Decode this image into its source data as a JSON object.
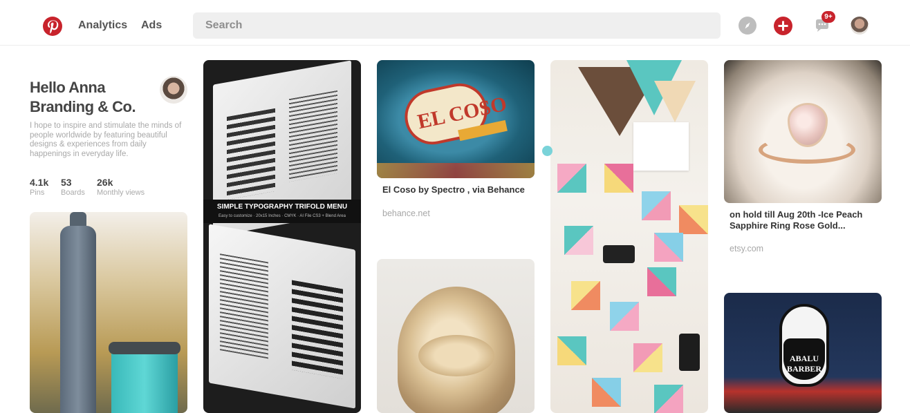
{
  "header": {
    "logo_icon": "pinterest-logo-icon",
    "nav": [
      {
        "label": "Analytics"
      },
      {
        "label": "Ads"
      }
    ],
    "search": {
      "placeholder": "Search",
      "value": ""
    },
    "icons": {
      "compass": "compass-icon",
      "add": "add-icon",
      "messages": "messages-icon",
      "avatar": "user-avatar"
    },
    "messages_badge": "9+",
    "brand_color": "#c8232c"
  },
  "profile": {
    "name_line1": "Hello Anna",
    "name_line2": "Branding & Co.",
    "bio": "I hope to inspire and stimulate the minds of people worldwide by featuring beautiful designs & experiences from daily happenings in everyday life.",
    "stats": [
      {
        "value": "4.1k",
        "label": "Pins"
      },
      {
        "value": "53",
        "label": "Boards"
      },
      {
        "value": "26k",
        "label": "Monthly views"
      }
    ]
  },
  "pins": {
    "menu": {
      "banner": "SIMPLE TYPOGRAPHY TRIFOLD MENU",
      "banner_sub": "Easy to customize · 20x15 Inches · CMYK · AI File CS3 + Blend Area"
    },
    "elcoso": {
      "image_word": "EL COSO",
      "title": "El Coso by Spectro , via Behance",
      "source": "behance.net"
    },
    "ring": {
      "title": "on hold till Aug 20th -Ice Peach Sapphire Ring Rose Gold...",
      "source": "etsy.com"
    },
    "barber": {
      "image_word": "ABALU BARBER"
    }
  },
  "colors": {
    "accent": "#c8232c",
    "dot": "#7ad3d9",
    "muted_text": "#a7a7a7"
  }
}
